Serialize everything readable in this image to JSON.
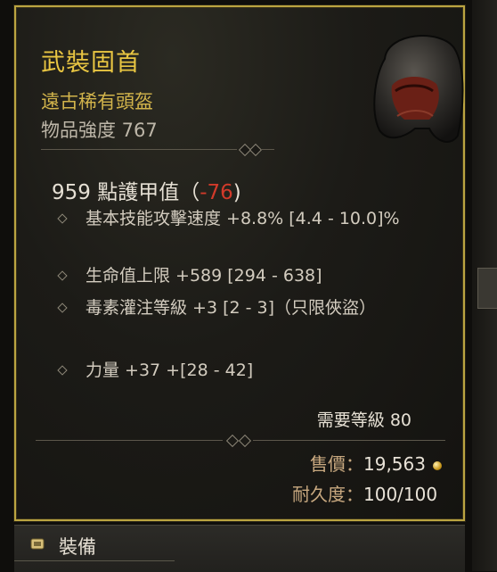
{
  "item": {
    "name": "武裝固首",
    "rarity": "遠古稀有頭盔",
    "item_power": "物品強度 767"
  },
  "stats": {
    "armor_main": "959 點護甲值",
    "armor_open": "（",
    "armor_delta": "-76",
    "armor_close": ")"
  },
  "affixes": [
    {
      "text": "基本技能攻擊速度 +8.8% [4.4 - 10.0]%"
    },
    {
      "text": "生命值上限 +589 [294 - 638]"
    },
    {
      "text": "毒素灌注等級 +3 [2 - 3]（只限俠盜）"
    },
    {
      "text": "力量 +37 +[28 - 42]"
    }
  ],
  "requirement": "需要等級 80",
  "sell": {
    "label": "售價：",
    "value": "19,563"
  },
  "durability": {
    "label": "耐久度：",
    "value": "100/100"
  },
  "bottom": {
    "equip_label": "裝備"
  },
  "colors": {
    "legendary_gold": "#e9c642",
    "border": "#bba441",
    "negative": "#d23a2a"
  }
}
